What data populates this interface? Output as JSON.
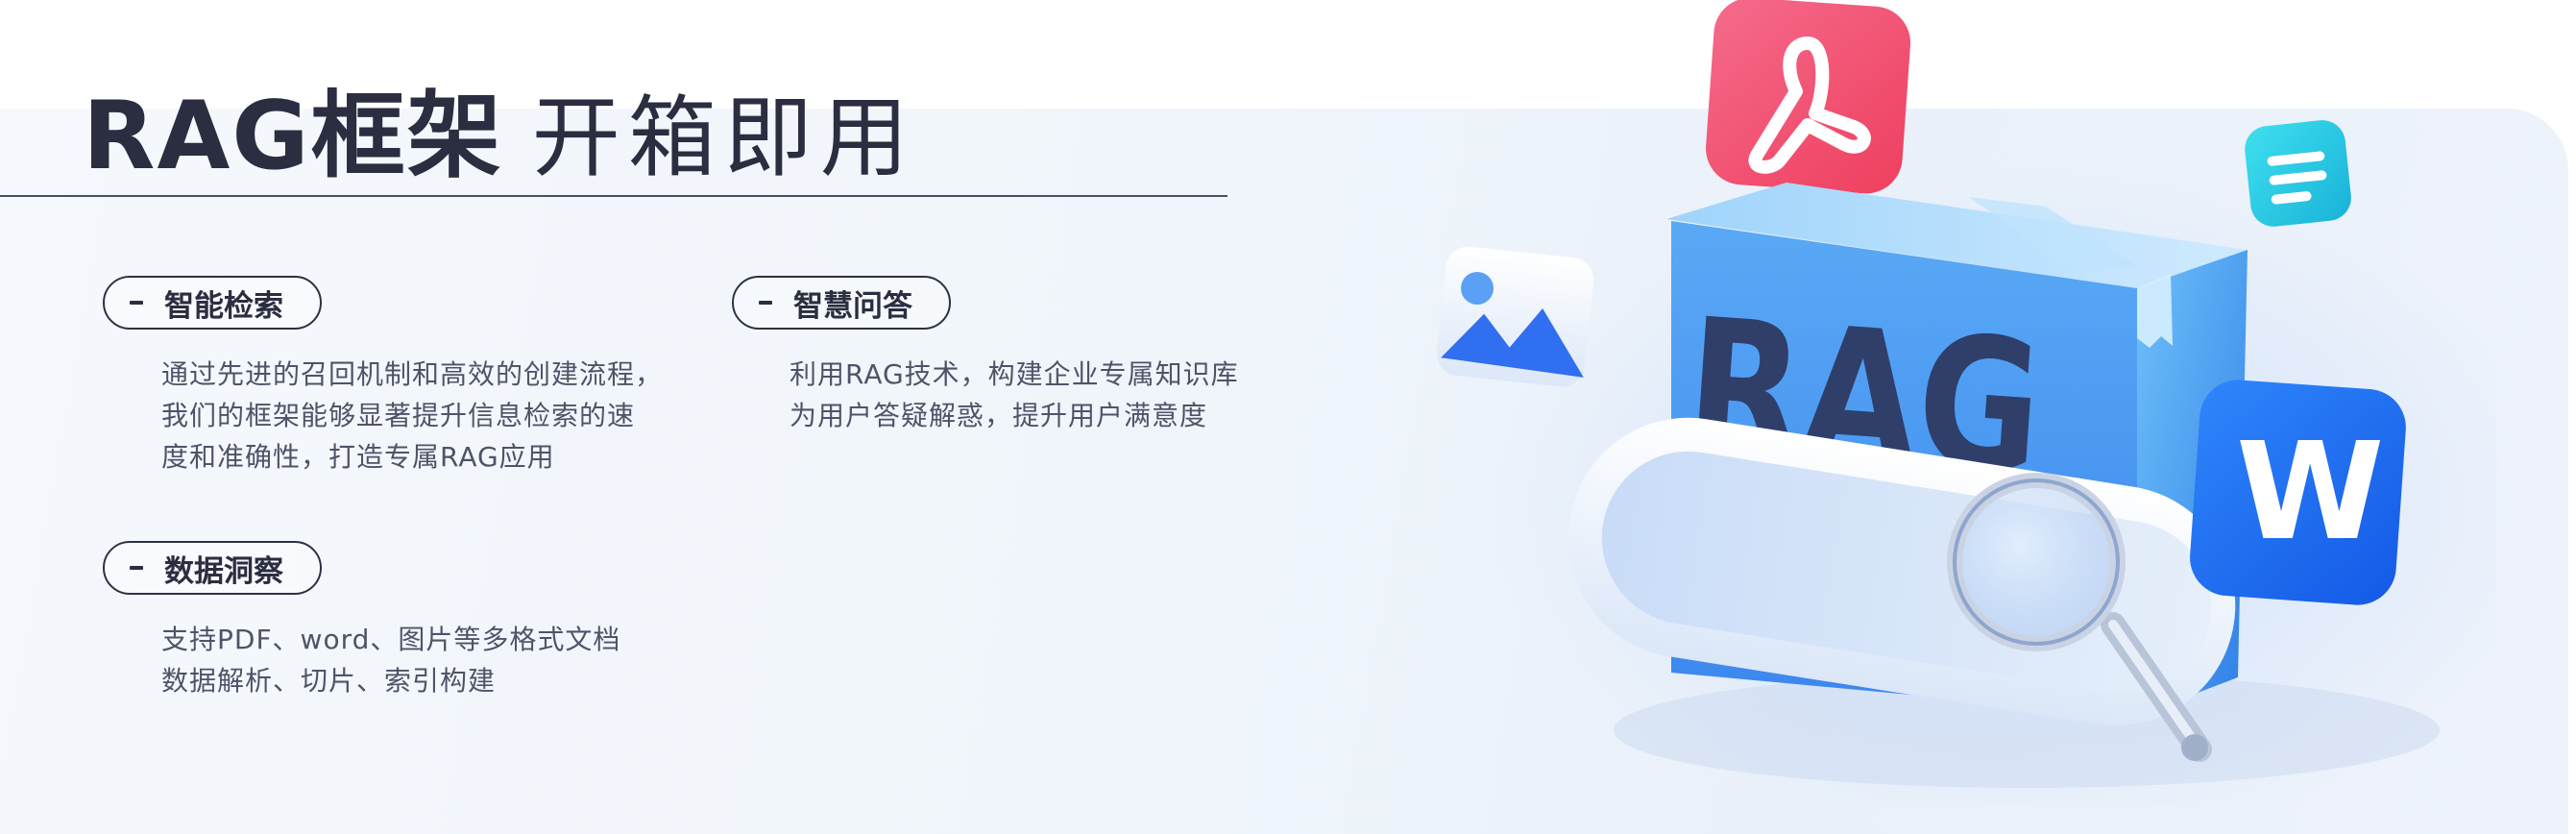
{
  "header": {
    "title_main": "RAG框架",
    "title_sub": "开箱即用"
  },
  "features": {
    "retrieval": {
      "label": "智能检索",
      "lines": [
        "通过先进的召回机制和高效的创建流程，",
        "我们的框架能够显著提升信息检索的速",
        "度和准确性，打造专属RAG应用"
      ]
    },
    "qa": {
      "label": "智慧问答",
      "lines": [
        "利用RAG技术，构建企业专属知识库",
        "为用户答疑解惑，提升用户满意度"
      ]
    },
    "insight": {
      "label": "数据洞察",
      "lines": [
        "支持PDF、word、图片等多格式文档",
        "数据解析、切片、索引构建"
      ]
    }
  },
  "illustration": {
    "box_label": "RAG",
    "word_badge": "W",
    "icons": [
      "pdf-icon",
      "document-icon",
      "image-icon",
      "word-icon",
      "magnifier-icon"
    ],
    "colors": {
      "pdf": "#f2536f",
      "doc": "#26c6e0",
      "word": "#1f6ff2",
      "box": "#4f9cf0",
      "text_dark": "#2b2d40"
    }
  }
}
